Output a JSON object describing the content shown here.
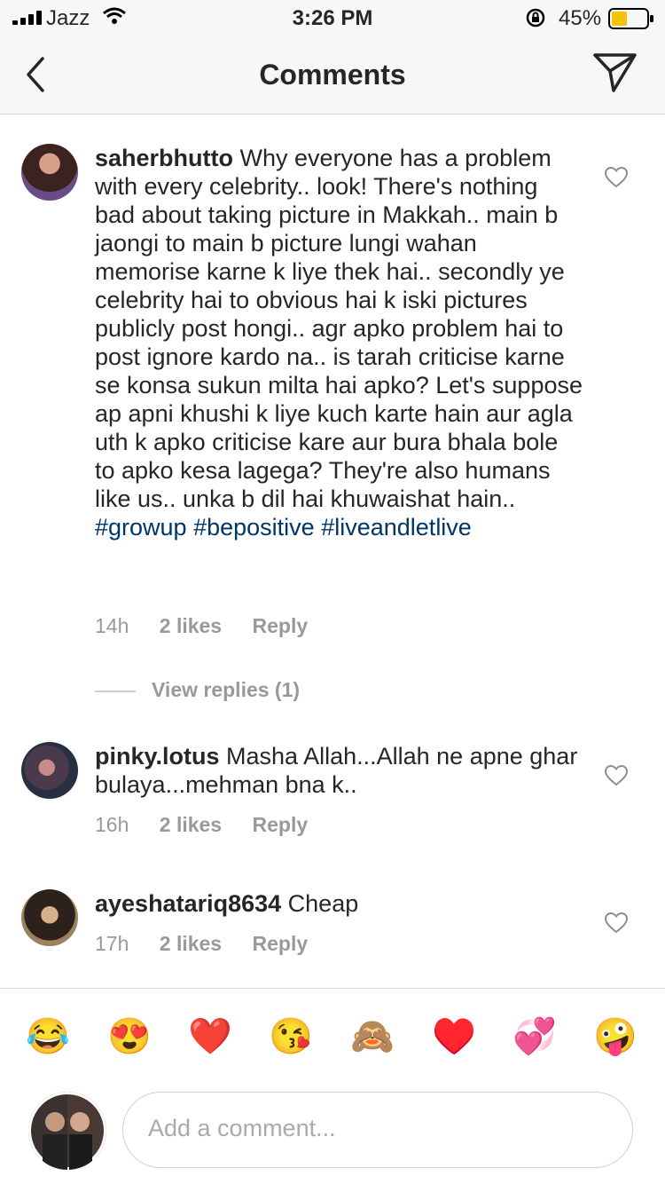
{
  "status_bar": {
    "carrier": "Jazz",
    "time": "3:26 PM",
    "battery_percent": "45%",
    "battery_level": 0.45,
    "battery_color": "#f5c400"
  },
  "nav": {
    "title": "Comments",
    "back_icon": "chevron-left-icon",
    "send_icon": "paper-plane-icon"
  },
  "comments": [
    {
      "username": "saherbhutto",
      "text": "Why everyone has a problem with every celebrity.. look! There's nothing bad about taking picture in Makkah.. main b jaongi to main b picture lungi wahan memorise karne k liye thek hai.. secondly ye celebrity hai to obvious hai k iski pictures publicly post hongi.. agr apko problem hai to post ignore kardo na.. is tarah criticise karne se konsa sukun milta hai apko? Let's suppose ap apni khushi k liye kuch karte hain aur agla uth k apko criticise kare aur bura bhala bole to apko kesa lagega? They're also humans like us.. unka b dil hai khuwaishat hain..",
      "hashtags": [
        "#growup",
        "#bepositive",
        "#liveandletlive"
      ],
      "time": "14h",
      "likes": "2 likes",
      "reply": "Reply",
      "view_replies": "View replies (1)"
    },
    {
      "username": "pinky.lotus",
      "text": "Masha Allah...Allah ne apne ghar bulaya...mehman bna k..",
      "time": "16h",
      "likes": "2 likes",
      "reply": "Reply"
    },
    {
      "username": "ayeshatariq8634",
      "text": "Cheap",
      "time": "17h",
      "likes": "2 likes",
      "reply": "Reply"
    }
  ],
  "emojis": [
    "😂",
    "😍",
    "❤️",
    "😘",
    "🙈",
    "♥️",
    "💞",
    "🤪"
  ],
  "composer": {
    "placeholder": "Add a comment..."
  },
  "colors": {
    "hashtag": "#003569",
    "meta": "#999999"
  }
}
